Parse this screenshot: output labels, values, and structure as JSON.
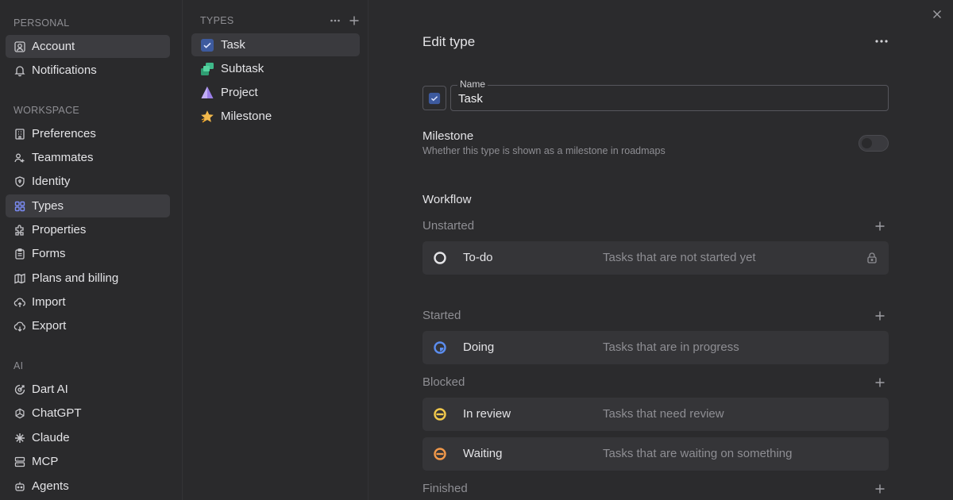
{
  "sidebar": {
    "sections": [
      {
        "label": "PERSONAL",
        "items": [
          {
            "label": "Account",
            "icon": "user-square-icon"
          },
          {
            "label": "Notifications",
            "icon": "bell-icon"
          }
        ]
      },
      {
        "label": "WORKSPACE",
        "items": [
          {
            "label": "Preferences",
            "icon": "building-icon"
          },
          {
            "label": "Teammates",
            "icon": "users-icon"
          },
          {
            "label": "Identity",
            "icon": "shield-icon"
          },
          {
            "label": "Types",
            "icon": "grid-icon"
          },
          {
            "label": "Properties",
            "icon": "puzzle-icon"
          },
          {
            "label": "Forms",
            "icon": "clipboard-icon"
          },
          {
            "label": "Plans and billing",
            "icon": "map-icon"
          },
          {
            "label": "Import",
            "icon": "cloud-upload-icon"
          },
          {
            "label": "Export",
            "icon": "cloud-download-icon"
          }
        ]
      },
      {
        "label": "AI",
        "items": [
          {
            "label": "Dart AI",
            "icon": "dart-icon"
          },
          {
            "label": "ChatGPT",
            "icon": "openai-icon"
          },
          {
            "label": "Claude",
            "icon": "claude-icon"
          },
          {
            "label": "MCP",
            "icon": "server-icon"
          },
          {
            "label": "Agents",
            "icon": "bot-icon"
          }
        ]
      }
    ],
    "active_items": [
      "Account",
      "Types"
    ]
  },
  "types_panel": {
    "header": "TYPES",
    "items": [
      {
        "label": "Task",
        "icon": "checkbox-icon"
      },
      {
        "label": "Subtask",
        "icon": "subtask-icon"
      },
      {
        "label": "Project",
        "icon": "pyramid-icon"
      },
      {
        "label": "Milestone",
        "icon": "star-icon"
      }
    ],
    "active": "Task"
  },
  "editor": {
    "title": "Edit type",
    "name_label": "Name",
    "name_value": "Task",
    "milestone": {
      "title": "Milestone",
      "description": "Whether this type is shown as a milestone in roadmaps",
      "enabled": false
    },
    "workflow_title": "Workflow",
    "groups": [
      {
        "label": "Unstarted",
        "statuses": [
          {
            "name": "To-do",
            "description": "Tasks that are not started yet",
            "icon": "circle-outline-icon",
            "color": "#e4e4e7",
            "locked": true
          }
        ]
      },
      {
        "label": "Started",
        "statuses": [
          {
            "name": "Doing",
            "description": "Tasks that are in progress",
            "icon": "progress-icon",
            "color": "#5b8def",
            "locked": false
          }
        ]
      },
      {
        "label": "Blocked",
        "statuses": [
          {
            "name": "In review",
            "description": "Tasks that need review",
            "icon": "minus-circle-icon",
            "color": "#f2c94c",
            "locked": false
          },
          {
            "name": "Waiting",
            "description": "Tasks that are waiting on something",
            "icon": "minus-circle-icon",
            "color": "#f2994a",
            "locked": false
          }
        ]
      },
      {
        "label": "Finished",
        "statuses": []
      }
    ]
  },
  "colors": {
    "accent": "#6c7ff2",
    "task_icon_bg": "#3d5a9e",
    "subtask_green": "#3fb98a",
    "project_purple": "#9b7fe8",
    "milestone_yellow": "#f2b84b"
  }
}
